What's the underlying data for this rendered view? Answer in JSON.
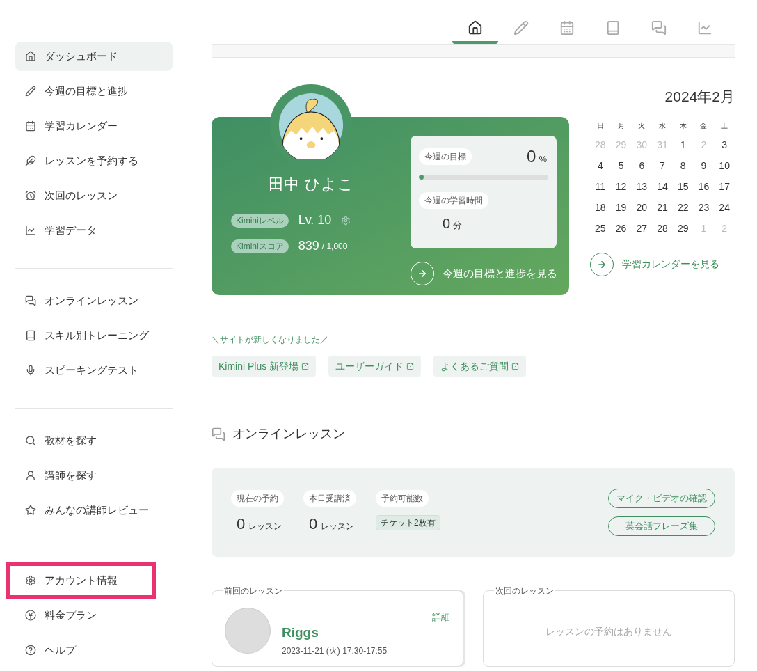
{
  "top_tabs": [
    {
      "selected": true
    },
    {
      "selected": false
    },
    {
      "selected": false
    },
    {
      "selected": false
    },
    {
      "selected": false
    },
    {
      "selected": false
    }
  ],
  "sidebar": {
    "groups": [
      {
        "items": [
          {
            "label": "ダッシュボード",
            "selected": true,
            "highlighted": false
          },
          {
            "label": "今週の目標と進捗",
            "selected": false,
            "highlighted": false
          },
          {
            "label": "学習カレンダー",
            "selected": false,
            "highlighted": false
          },
          {
            "label": "レッスンを予約する",
            "selected": false,
            "highlighted": false
          },
          {
            "label": "次回のレッスン",
            "selected": false,
            "highlighted": false
          },
          {
            "label": "学習データ",
            "selected": false,
            "highlighted": false
          }
        ]
      },
      {
        "items": [
          {
            "label": "オンラインレッスン",
            "selected": false,
            "highlighted": false
          },
          {
            "label": "スキル別トレーニング",
            "selected": false,
            "highlighted": false
          },
          {
            "label": "スピーキングテスト",
            "selected": false,
            "highlighted": false
          }
        ]
      },
      {
        "items": [
          {
            "label": "教材を探す",
            "selected": false,
            "highlighted": false
          },
          {
            "label": "講師を探す",
            "selected": false,
            "highlighted": false
          },
          {
            "label": "みんなの講師レビュー",
            "selected": false,
            "highlighted": false
          }
        ]
      },
      {
        "items": [
          {
            "label": "アカウント情報",
            "selected": false,
            "highlighted": true
          },
          {
            "label": "料金プラン",
            "selected": false,
            "highlighted": false
          },
          {
            "label": "ヘルプ",
            "selected": false,
            "highlighted": false
          }
        ]
      }
    ]
  },
  "profile": {
    "name": "田中 ひよこ",
    "stats": [
      {
        "kind": "level",
        "badge": "Kiminiレベル",
        "value": "Lv. 10"
      },
      {
        "kind": "score",
        "badge": "Kiminiスコア",
        "value": "839",
        "suffix": "/ 1,000"
      }
    ],
    "goal": {
      "label": "今週の目標",
      "value": "0",
      "unit": "%",
      "level": 0.02
    },
    "study_time": {
      "label": "今週の学習時間",
      "value": "0",
      "unit": "分"
    },
    "link": "今週の目標と進捗を見る"
  },
  "calendar": {
    "title": "2024年2月",
    "weekdays": [
      "日",
      "月",
      "火",
      "水",
      "木",
      "金",
      "土"
    ],
    "weeks": [
      [
        {
          "day": "28",
          "muted": true
        },
        {
          "day": "29",
          "muted": true
        },
        {
          "day": "30",
          "muted": true
        },
        {
          "day": "31",
          "muted": true
        },
        {
          "day": "1",
          "muted": false
        },
        {
          "day": "2",
          "muted": true
        },
        {
          "day": "3",
          "muted": false
        }
      ],
      [
        {
          "day": "4",
          "muted": false
        },
        {
          "day": "5",
          "muted": false
        },
        {
          "day": "6",
          "muted": false
        },
        {
          "day": "7",
          "muted": false
        },
        {
          "day": "8",
          "muted": false
        },
        {
          "day": "9",
          "muted": false
        },
        {
          "day": "10",
          "muted": false
        }
      ],
      [
        {
          "day": "11",
          "muted": false
        },
        {
          "day": "12",
          "muted": false
        },
        {
          "day": "13",
          "muted": false
        },
        {
          "day": "14",
          "muted": false
        },
        {
          "day": "15",
          "muted": false
        },
        {
          "day": "16",
          "muted": false
        },
        {
          "day": "17",
          "muted": false
        }
      ],
      [
        {
          "day": "18",
          "muted": false
        },
        {
          "day": "19",
          "muted": false
        },
        {
          "day": "20",
          "muted": false
        },
        {
          "day": "21",
          "muted": false
        },
        {
          "day": "22",
          "muted": false
        },
        {
          "day": "23",
          "muted": false
        },
        {
          "day": "24",
          "muted": false
        }
      ],
      [
        {
          "day": "25",
          "muted": false
        },
        {
          "day": "26",
          "muted": false
        },
        {
          "day": "27",
          "muted": false
        },
        {
          "day": "28",
          "muted": false
        },
        {
          "day": "29",
          "muted": false
        },
        {
          "day": "1",
          "muted": true
        },
        {
          "day": "2",
          "muted": true
        }
      ]
    ],
    "link": "学習カレンダーを見る"
  },
  "news": {
    "caption": "＼サイトが新しくなりました／",
    "links": [
      "Kimini Plus 新登場",
      "ユーザーガイド",
      "よくあるご質問"
    ]
  },
  "online_lessons": {
    "heading": "オンラインレッスン",
    "stats": [
      {
        "kind": "count",
        "label": "現在の予約",
        "value": "0",
        "unit": "レッスン"
      },
      {
        "kind": "count",
        "label": "本日受講済",
        "value": "0",
        "unit": "レッスン"
      },
      {
        "kind": "ticket",
        "label": "予約可能数",
        "value": "チケット2枚有"
      }
    ],
    "buttons": [
      "マイク・ビデオの確認",
      "英会話フレーズ集"
    ]
  },
  "previous_lesson": {
    "title": "前回のレッスン",
    "detail": "詳細",
    "teacher": "Riggs",
    "datetime": "2023-11-21 (火) 17:30-17:55"
  },
  "next_lesson": {
    "title": "次回のレッスン",
    "empty": "レッスンの予約はありません"
  }
}
